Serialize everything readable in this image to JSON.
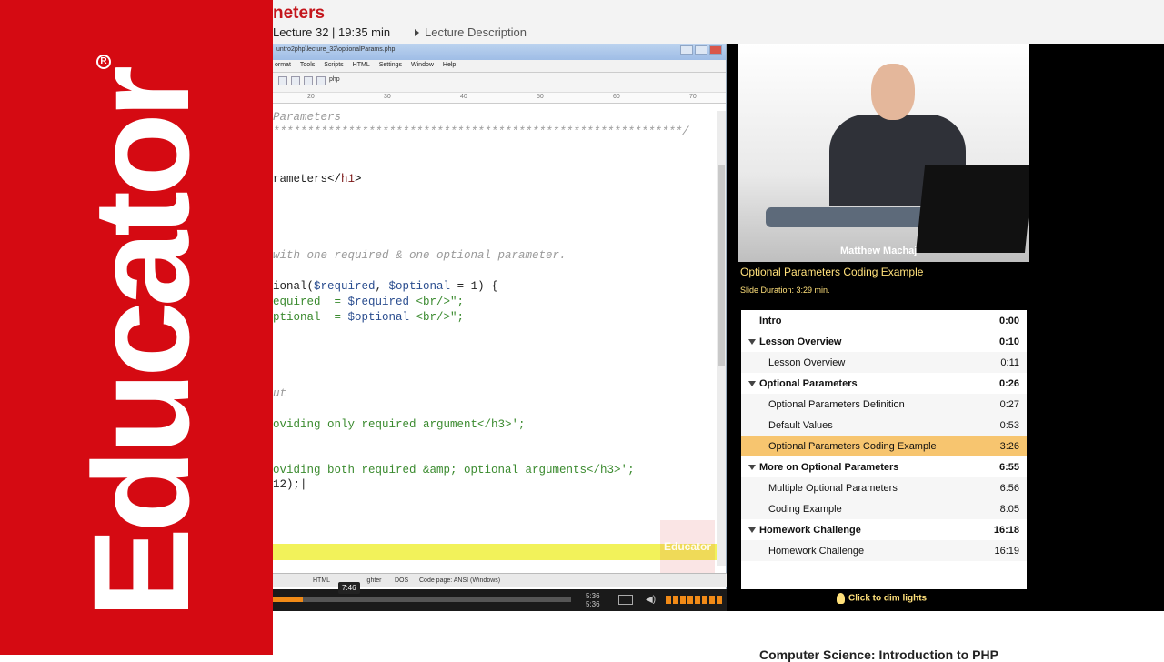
{
  "brand": {
    "name": "Educator",
    "reg_mark": "R"
  },
  "header": {
    "lecture_title": "neters",
    "lecture_meta": "Lecture 32 | 19:35 min",
    "lecture_desc": "Lecture Description"
  },
  "editor": {
    "window_title": "untro2php\\lecture_32\\optionalParams.php",
    "menu": [
      "ormat",
      "Tools",
      "Scripts",
      "HTML",
      "Settings",
      "Window",
      "Help"
    ],
    "file_tab": "php",
    "ruler_ticks": [
      "20",
      "30",
      "40",
      "50",
      "60",
      "70"
    ],
    "status": {
      "lang": "HTML",
      "tip_time": "7:46",
      "highlighter": "ighter",
      "eol": "DOS",
      "codepage": "Code page: ANSI (Windows)"
    },
    "watermark": "Educator"
  },
  "player": {
    "time_current": "5:36",
    "time_total": "5:36",
    "progress_fraction": 0.1,
    "presenter": "Matthew Machaj"
  },
  "slide": {
    "title": "Optional Parameters Coding Example",
    "duration": "Slide Duration: 3:29 min."
  },
  "toc": [
    {
      "label": "Intro",
      "time": "0:00",
      "type": "section"
    },
    {
      "label": "Lesson Overview",
      "time": "0:10",
      "type": "section"
    },
    {
      "label": "Lesson Overview",
      "time": "0:11",
      "type": "sub"
    },
    {
      "label": "Optional Parameters",
      "time": "0:26",
      "type": "section"
    },
    {
      "label": "Optional Parameters Definition",
      "time": "0:27",
      "type": "sub"
    },
    {
      "label": "Default Values",
      "time": "0:53",
      "type": "sub"
    },
    {
      "label": "Optional Parameters Coding Example",
      "time": "3:26",
      "type": "active"
    },
    {
      "label": "More on Optional Parameters",
      "time": "6:55",
      "type": "section"
    },
    {
      "label": "Multiple Optional Parameters",
      "time": "6:56",
      "type": "sub"
    },
    {
      "label": "Coding Example",
      "time": "8:05",
      "type": "sub"
    },
    {
      "label": "Homework Challenge",
      "time": "16:18",
      "type": "section"
    },
    {
      "label": "Homework Challenge",
      "time": "16:19",
      "type": "sub"
    }
  ],
  "dim_lights": "Click to dim lights",
  "course_title": "Computer Science: Introduction to PHP"
}
